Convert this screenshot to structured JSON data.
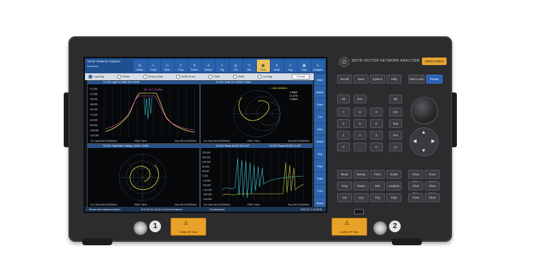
{
  "app": {
    "title": "Vector Network Analyzer",
    "subtitle": "Standard",
    "menu": [
      {
        "label": "Meas",
        "icon": "meas-icon",
        "glyph": "⊡"
      },
      {
        "label": "Trace",
        "icon": "trace-icon",
        "glyph": "∿"
      },
      {
        "label": "Chan",
        "icon": "channel-icon",
        "glyph": "▭"
      },
      {
        "label": "Freq",
        "icon": "frequency-icon",
        "glyph": "ƒ"
      },
      {
        "label": "Power",
        "icon": "power-level-icon",
        "glyph": "↯"
      },
      {
        "label": "Sweep",
        "icon": "sweep-icon",
        "glyph": "⇥"
      },
      {
        "label": "Trig",
        "icon": "trigger-icon",
        "glyph": "⌇"
      },
      {
        "label": "Cal",
        "icon": "calibration-icon",
        "glyph": "◎"
      },
      {
        "label": "Mrk",
        "icon": "marker-icon",
        "glyph": "▽"
      },
      {
        "label": "Form",
        "icon": "format-icon",
        "glyph": "▦"
      },
      {
        "label": "Scale",
        "icon": "scale-icon",
        "glyph": "⇕"
      },
      {
        "label": "Avg",
        "icon": "average-icon",
        "glyph": "≈"
      },
      {
        "label": "Disp",
        "icon": "display-icon",
        "glyph": "▣"
      },
      {
        "label": "Analysis",
        "icon": "analysis-icon",
        "glyph": "≡"
      }
    ],
    "selected_menu_index": 9,
    "format_options": [
      {
        "label": "Log Mag",
        "selected": true
      },
      {
        "label": "Phase",
        "selected": false
      },
      {
        "label": "Group Delay",
        "selected": false
      },
      {
        "label": "Smith Chart",
        "selected": false
      },
      {
        "label": "Polar",
        "selected": false
      },
      {
        "label": "SWR",
        "selected": false
      },
      {
        "label": "Lin Mag",
        "selected": false
      }
    ],
    "format_button": "Format",
    "sidebar": [
      "Meas",
      "Marker",
      "Trace",
      "Cal",
      "Save",
      "Recall",
      "Avg",
      "Disp",
      "Scale",
      "Freq",
      "Sweep"
    ],
    "panels": [
      {
        "header": "Tr1 S11 LogM 10.00dB/ Ref 0.00dB",
        "start": "Ch1 Start 800.000000MHz",
        "ifbw": "IFBW 70kHz",
        "stop": "Stop 900.000000MHz",
        "marker_readout": "M1 -16.7 TOdBm",
        "y_ticks": [
          "−12.000",
          "−24.000",
          "−36.000",
          "−48.000",
          "−60.000",
          "−72.000",
          "−84.000",
          "−96.000",
          "−108.000",
          "−120.000"
        ]
      },
      {
        "header": "Tr2 S11 Smith 1U 1.000U/ 1.000U",
        "start": "Ch1 Start 800.000000MHz",
        "ifbw": "IFBW 70kHz",
        "stop": "Stop 900.000000MHz",
        "marker_freq": "> 1 800.000MHz",
        "marker_vals": [
          "2.0563",
          "11.27Ω",
          "1.99nH"
        ]
      },
      {
        "header": "Tr3 S11 Polar/Smith LinMag 1.000U/ 1.000U",
        "start": "Ch1 Start 800.000000MHz",
        "ifbw": "IFBW 70kHz",
        "stop": "Stop 900.000000MHz"
      },
      {
        "header": "Tr4 S21 Phase 45.00°/ Ref 0.00°",
        "header2": "Tr5 S21 Phase 45.000°/ 0.000°",
        "start": "Ch1 Start 800.000000MHz",
        "ifbw": "IFBW 70kHz",
        "stop": "Stop 900.000000MHz",
        "y_ticks": [
          "225.000",
          "180.000",
          "135.000",
          "90.000",
          "45.000",
          "0.000",
          "−45.000",
          "−90.000",
          "−135.000",
          "−180.000",
          "−225.000"
        ]
      }
    ],
    "status_left": "Please enter instrument status",
    "status_mid": "CH1 M1 S21 Sc11m Ctrl Int Ref Internal",
    "status_right": "Ext Instrument",
    "status_clock": "2023-12-17 11:38:50"
  },
  "front_panel": {
    "brand": "3657B VECTOR NETWORK ANALYZER",
    "freq_badge": "10MHz-9GHz",
    "top_keys": [
      "Recall",
      "Save",
      "System",
      "Help"
    ],
    "mode_keys": [
      "Start Local",
      "Preset"
    ],
    "keypad": [
      "Ok",
      "Esc",
      "Bk",
      "7",
      "8",
      "9",
      "G/n",
      "4",
      "5",
      "6",
      "M/μ",
      "1",
      "2",
      "3",
      "k/m",
      "0",
      ".",
      "+/-",
      "x1"
    ],
    "func_keys": [
      "Meas",
      "Sweep",
      "Form",
      "Scale",
      "Freq",
      "Power",
      "Mrk",
      "Analysis",
      "Cal",
      "Avg",
      "Trig",
      "Disp"
    ],
    "right_keys": [
      "Trace Prev",
      "Trace Next",
      "Chan Prev",
      "Chan Next",
      "Trace",
      "Chan"
    ],
    "ports": [
      "1",
      "2"
    ],
    "warning_label": "Ds/Bm RF Max",
    "colors": {
      "accent": "#2962b8",
      "badge": "#e8a233",
      "warning": "#e9a228"
    }
  }
}
